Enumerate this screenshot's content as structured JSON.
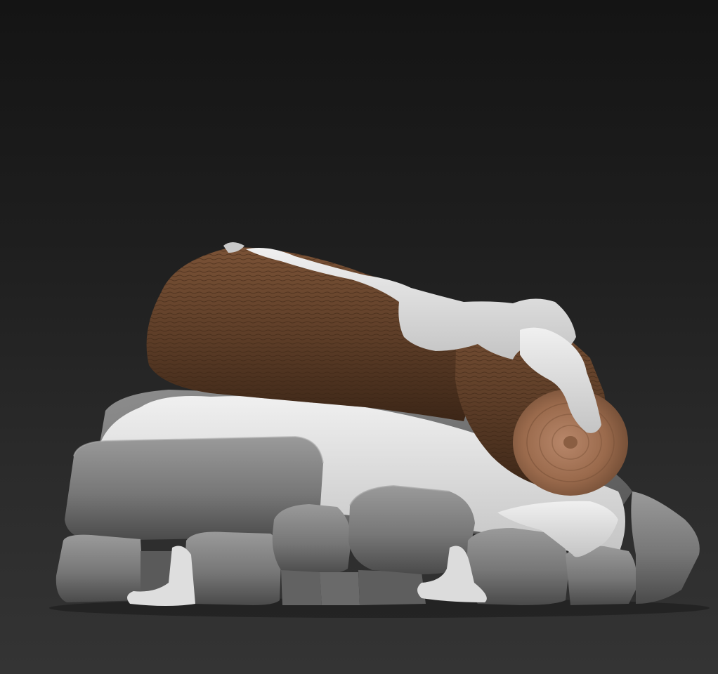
{
  "viewport": {
    "background_top": "#141414",
    "background_bottom": "#343434"
  },
  "model": {
    "subject": "snow-covered-log-on-stones-sculpt",
    "colors": {
      "stone": "#767676",
      "stone_dark": "#4a4a4a",
      "stone_light": "#9c9c9c",
      "snow": "#e2e2e2",
      "snow_shadow": "#b9b9b9",
      "bark": "#5e3e28",
      "bark_dark": "#3c2617",
      "bark_light": "#7a5236",
      "cut_end": "#9a6a4c",
      "cut_end_light": "#b8876a"
    }
  }
}
